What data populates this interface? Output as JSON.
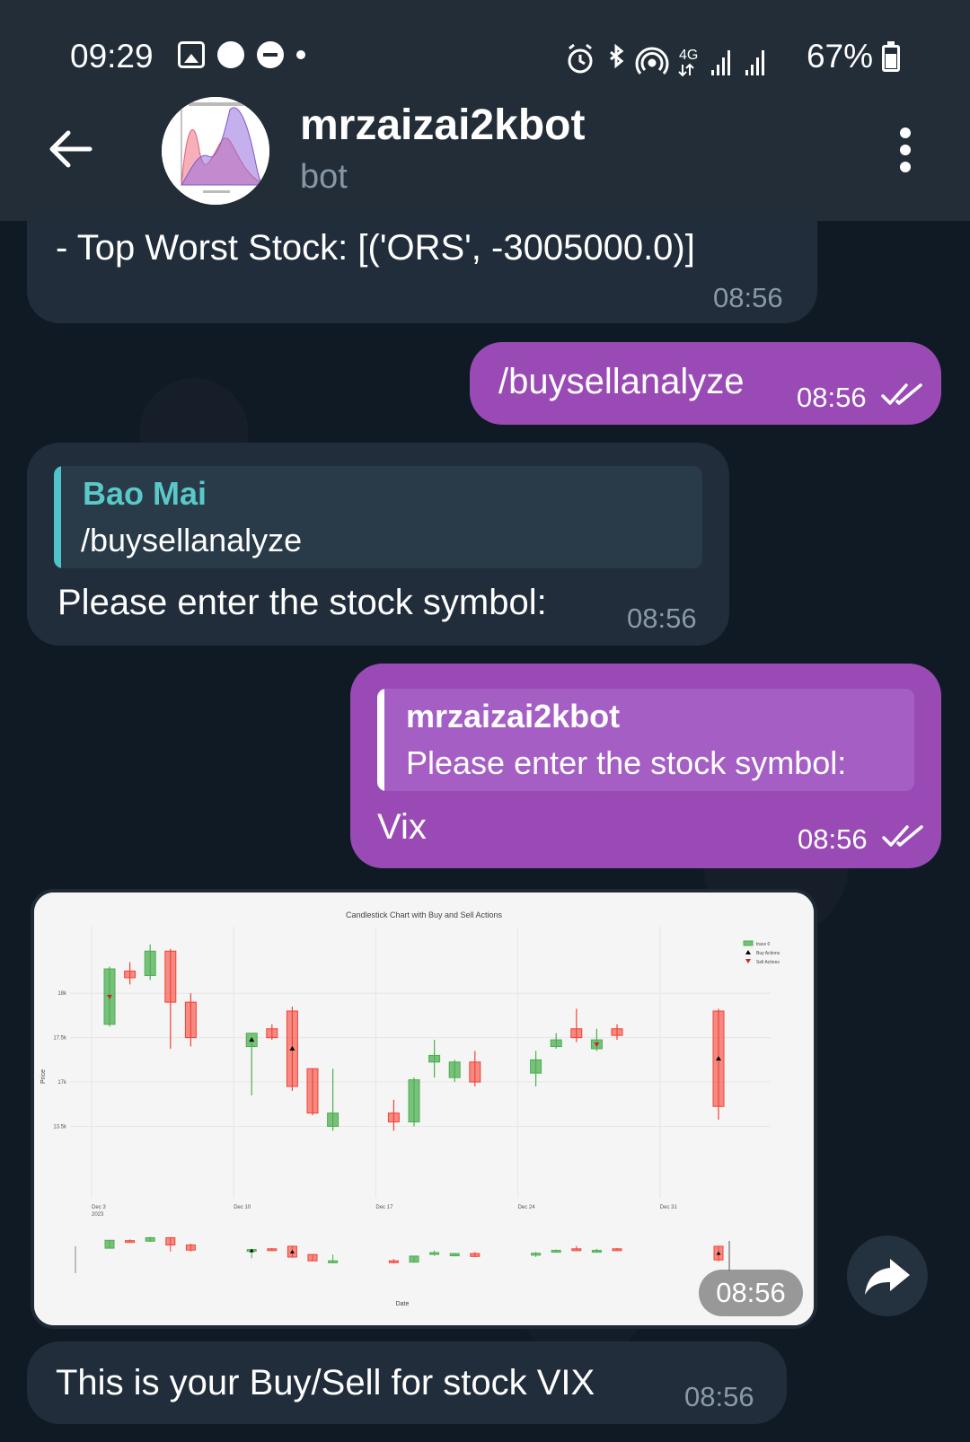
{
  "status_bar": {
    "time": "09:29",
    "network": "4G",
    "battery": "67%",
    "battery_level": 0.67
  },
  "header": {
    "title": "mrzaizai2kbot",
    "subtitle": "bot"
  },
  "messages": {
    "m1": {
      "text": "- Top Worst Stock: [('ORS', -3005000.0)]",
      "time": "08:56"
    },
    "m2": {
      "text": "/buysellanalyze",
      "time": "08:56"
    },
    "m3": {
      "reply_name": "Bao Mai",
      "reply_text": "/buysellanalyze",
      "text": "Please enter the stock symbol:",
      "time": "08:56"
    },
    "m4": {
      "reply_name": "mrzaizai2kbot",
      "reply_text": "Please enter the stock symbol:",
      "text": "Vix",
      "time": "08:56"
    },
    "m5": {
      "time": "08:56"
    },
    "m6": {
      "text": "This is your Buy/Sell for stock VIX",
      "time": "08:56"
    }
  },
  "colors": {
    "incoming_bubble": "#212d3b",
    "outgoing_bubble": "#9a4ab5",
    "reply_accent_in": "#4fc3c9",
    "header_bg": "#222d38",
    "candle_up": "#4caf50",
    "candle_down": "#f44336"
  },
  "chart_data": {
    "type": "candlestick",
    "title": "Candlestick Chart with Buy and Sell Actions",
    "xlabel": "Date",
    "ylabel": "Price",
    "xticks": [
      "Dec 3\n2023",
      "Dec 10",
      "Dec 17",
      "Dec 24",
      "Dec 31"
    ],
    "yticks": [
      "13.5k",
      "17k",
      "17.5k",
      "18k"
    ],
    "ylim": [
      13.2,
      18.3
    ],
    "legend": [
      "trace 0",
      "Buy Actions",
      "Sell Actions"
    ],
    "candles": [
      {
        "x": 0,
        "open": 16.3,
        "high": 17.6,
        "low": 16.25,
        "close": 17.55,
        "dir": "up"
      },
      {
        "x": 1,
        "open": 17.5,
        "high": 17.7,
        "low": 17.2,
        "close": 17.35,
        "dir": "down"
      },
      {
        "x": 2,
        "open": 17.4,
        "high": 18.1,
        "low": 17.3,
        "close": 17.95,
        "dir": "up"
      },
      {
        "x": 3,
        "open": 17.95,
        "high": 18.0,
        "low": 15.75,
        "close": 16.8,
        "dir": "down"
      },
      {
        "x": 4,
        "open": 16.8,
        "high": 17.0,
        "low": 15.8,
        "close": 16.0,
        "dir": "down"
      },
      {
        "x": 7,
        "open": 15.8,
        "high": 16.0,
        "low": 14.7,
        "close": 16.1,
        "dir": "up"
      },
      {
        "x": 8,
        "open": 16.2,
        "high": 16.3,
        "low": 15.95,
        "close": 16.0,
        "dir": "down"
      },
      {
        "x": 9,
        "open": 16.6,
        "high": 16.7,
        "low": 14.8,
        "close": 14.9,
        "dir": "down"
      },
      {
        "x": 10,
        "open": 15.3,
        "high": 15.3,
        "low": 14.25,
        "close": 14.3,
        "dir": "down"
      },
      {
        "x": 11,
        "open": 14.3,
        "high": 15.3,
        "low": 13.9,
        "close": 14.0,
        "dir": "up"
      },
      {
        "x": 14,
        "open": 14.3,
        "high": 14.6,
        "low": 13.9,
        "close": 14.1,
        "dir": "down"
      },
      {
        "x": 15,
        "open": 14.1,
        "high": 15.1,
        "low": 14.0,
        "close": 15.05,
        "dir": "up"
      },
      {
        "x": 16,
        "open": 15.45,
        "high": 15.95,
        "low": 15.1,
        "close": 15.6,
        "dir": "up"
      },
      {
        "x": 17,
        "open": 15.1,
        "high": 15.5,
        "low": 15.0,
        "close": 15.45,
        "dir": "up"
      },
      {
        "x": 18,
        "open": 15.45,
        "high": 15.7,
        "low": 14.9,
        "close": 15.0,
        "dir": "down"
      },
      {
        "x": 21,
        "open": 15.2,
        "high": 15.7,
        "low": 14.9,
        "close": 15.5,
        "dir": "up"
      },
      {
        "x": 22,
        "open": 15.8,
        "high": 16.1,
        "low": 15.75,
        "close": 15.95,
        "dir": "up"
      },
      {
        "x": 23,
        "open": 16.2,
        "high": 16.65,
        "low": 15.9,
        "close": 16.0,
        "dir": "down"
      },
      {
        "x": 24,
        "open": 15.75,
        "high": 16.2,
        "low": 15.7,
        "close": 15.95,
        "dir": "up"
      },
      {
        "x": 25,
        "open": 16.2,
        "high": 16.3,
        "low": 15.95,
        "close": 16.05,
        "dir": "down"
      },
      {
        "x": 30,
        "open": 16.6,
        "high": 16.65,
        "low": 14.15,
        "close": 14.45,
        "dir": "down"
      }
    ],
    "buy_actions": [
      7,
      9,
      30
    ],
    "sell_actions": [
      0,
      24
    ]
  }
}
